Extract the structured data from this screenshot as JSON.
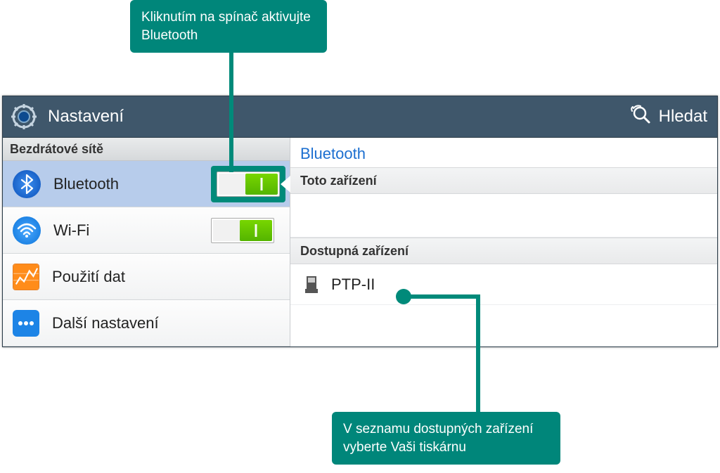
{
  "callouts": {
    "top": "Kliknutím na spínač aktivujte Bluetooth",
    "bottom": "V seznamu dostupných zařízení vyberte Vaši tiskárnu"
  },
  "header": {
    "title": "Nastavení",
    "search_label": "Hledat"
  },
  "sidebar": {
    "section_header": "Bezdrátové sítě",
    "items": [
      {
        "label": "Bluetooth"
      },
      {
        "label": "Wi-Fi"
      },
      {
        "label": "Použití dat"
      },
      {
        "label": "Další nastavení"
      }
    ]
  },
  "main": {
    "title": "Bluetooth",
    "this_device_header": "Toto zařízení",
    "available_header": "Dostupná zařízení",
    "devices": [
      {
        "name": "PTP-II"
      }
    ]
  }
}
